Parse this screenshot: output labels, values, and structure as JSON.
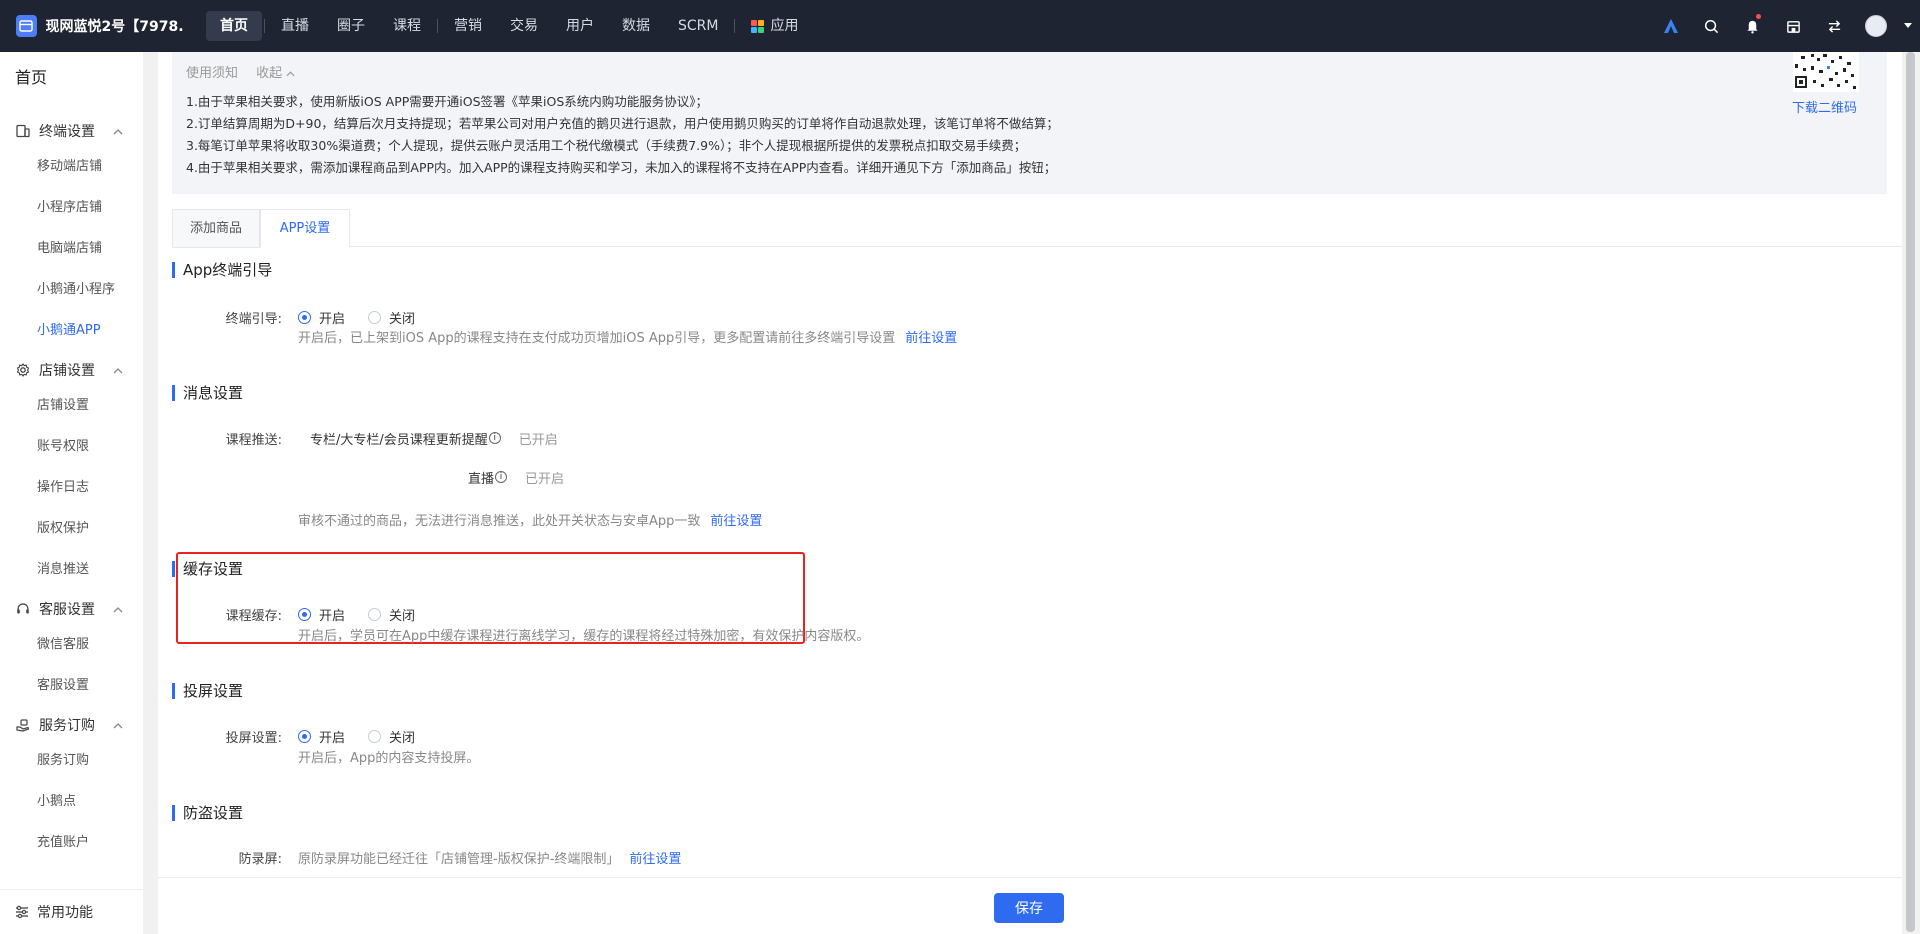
{
  "topnav": {
    "brand": "现网蓝悦2号【7978...",
    "items": [
      {
        "label": "首页",
        "active": true
      },
      {
        "label": "直播"
      },
      {
        "label": "圈子"
      },
      {
        "label": "课程"
      },
      {
        "label": "营销"
      },
      {
        "label": "交易"
      },
      {
        "label": "用户"
      },
      {
        "label": "数据"
      },
      {
        "label": "SCRM"
      },
      {
        "label": "应用"
      }
    ]
  },
  "sidebar": {
    "home": "首页",
    "groups": [
      {
        "label": "终端设置",
        "icon": "terminal-icon",
        "items": [
          "移动端店铺",
          "小程序店铺",
          "电脑端店铺",
          "小鹅通小程序",
          "小鹅通APP"
        ]
      },
      {
        "label": "店铺设置",
        "icon": "gear-icon",
        "items": [
          "店铺设置",
          "账号权限",
          "操作日志",
          "版权保护",
          "消息推送"
        ]
      },
      {
        "label": "客服设置",
        "icon": "headset-icon",
        "items": [
          "微信客服",
          "客服设置"
        ]
      },
      {
        "label": "服务订购",
        "icon": "hand-icon",
        "items": [
          "服务订购",
          "小鹅点",
          "充值账户"
        ]
      }
    ],
    "active_item": "小鹅通APP",
    "bottom": "常用功能"
  },
  "notice": {
    "head": "使用须知",
    "fold": "收起",
    "lines": [
      "1.由于苹果相关要求，使用新版iOS APP需要开通iOS签署《苹果iOS系统内购功能服务协议》；",
      "2.订单结算周期为D+90，结算后次月支持提现；若苹果公司对用户充值的鹅贝进行退款，用户使用鹅贝购买的订单将作自动退款处理，该笔订单将不做结算；",
      "3.每笔订单苹果将收取30%渠道费；个人提现，提供云账户灵活用工个税代缴模式（手续费7.9%）；非个人提现根据所提供的发票税点扣取交易手续费；",
      "4.由于苹果相关要求，需添加课程商品到APP内。加入APP的课程支持购买和学习，未加入的课程将不支持在APP内查看。详细开通见下方「添加商品」按钮；"
    ],
    "qr_link": "下载二维码"
  },
  "tabs": [
    {
      "label": "添加商品"
    },
    {
      "label": "APP设置",
      "active": true
    }
  ],
  "sections": {
    "terminal": {
      "title": "App终端引导",
      "label": "终端引导:",
      "on": "开启",
      "off": "关闭",
      "hint": "开启后，已上架到iOS App的课程支持在支付成功页增加iOS App引导，更多配置请前往多终端引导设置",
      "link": "前往设置"
    },
    "message": {
      "title": "消息设置",
      "label": "课程推送:",
      "item1": "专栏/大专栏/会员课程更新提醒",
      "item1_status": "已开启",
      "item2": "直播",
      "item2_status": "已开启",
      "hint": "审核不通过的商品，无法进行消息推送，此处开关状态与安卓App一致",
      "link": "前往设置"
    },
    "cache": {
      "title": "缓存设置",
      "label": "课程缓存:",
      "on": "开启",
      "off": "关闭",
      "hint": "开启后，学员可在App中缓存课程进行离线学习，缓存的课程将经过特殊加密，有效保护内容版权。"
    },
    "cast": {
      "title": "投屏设置",
      "label": "投屏设置:",
      "on": "开启",
      "off": "关闭",
      "hint": "开启后，App的内容支持投屏。"
    },
    "antitheft": {
      "title": "防盗设置",
      "label": "防录屏:",
      "hint": "原防录屏功能已经迁往「店铺管理-版权保护-终端限制」",
      "link": "前往设置"
    }
  },
  "footer": {
    "save": "保存"
  },
  "colors": {
    "accent": "#2f6bf0",
    "nav_bg": "#1e2432",
    "highlight": "#e8231f"
  }
}
